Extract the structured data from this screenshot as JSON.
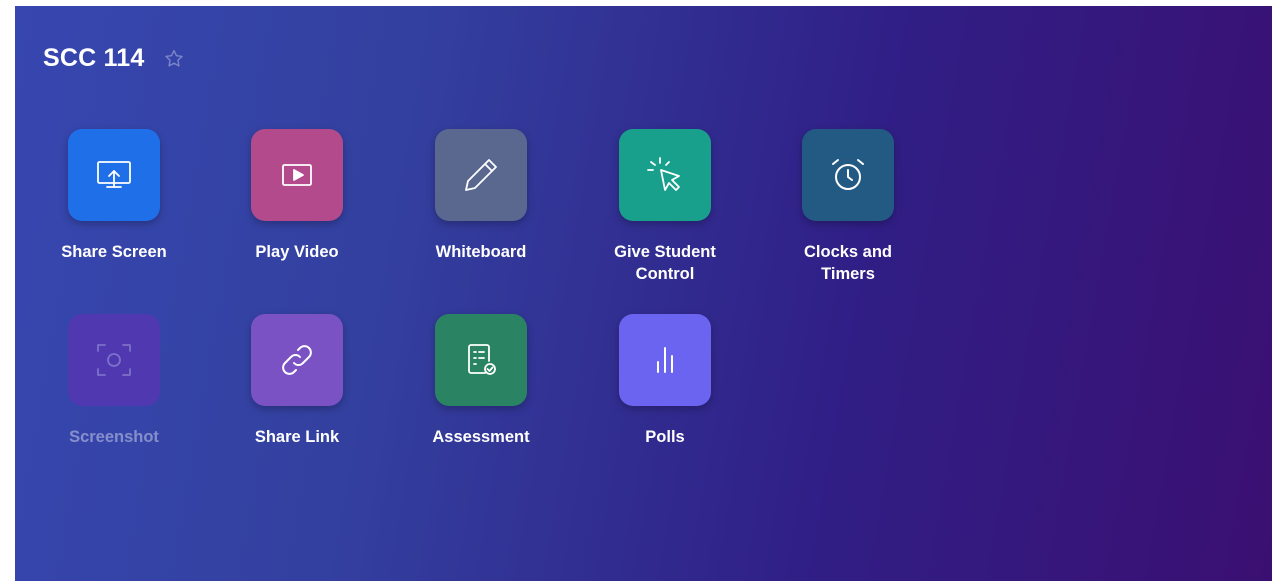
{
  "header": {
    "title": "SCC 114",
    "favorite_icon": "star-outline-icon"
  },
  "tiles": [
    {
      "label": "Share Screen",
      "icon": "share-screen-icon",
      "color": "#1f6fe8",
      "enabled": true
    },
    {
      "label": "Play Video",
      "icon": "play-video-icon",
      "color": "#b24a8c",
      "enabled": true
    },
    {
      "label": "Whiteboard",
      "icon": "pencil-icon",
      "color": "#5a6890",
      "enabled": true
    },
    {
      "label": "Give Student\nControl",
      "icon": "cursor-click-icon",
      "color": "#18a08c",
      "enabled": true
    },
    {
      "label": "Clocks and\nTimers",
      "icon": "alarm-clock-icon",
      "color": "#235a84",
      "enabled": true
    },
    {
      "label": "Screenshot",
      "icon": "screenshot-icon",
      "color": "#5a3cb8",
      "enabled": false
    },
    {
      "label": "Share Link",
      "icon": "link-icon",
      "color": "#7a52c4",
      "enabled": true
    },
    {
      "label": "Assessment",
      "icon": "assessment-icon",
      "color": "#2a8464",
      "enabled": true
    },
    {
      "label": "Polls",
      "icon": "bar-chart-icon",
      "color": "#6b64f0",
      "enabled": true
    }
  ]
}
